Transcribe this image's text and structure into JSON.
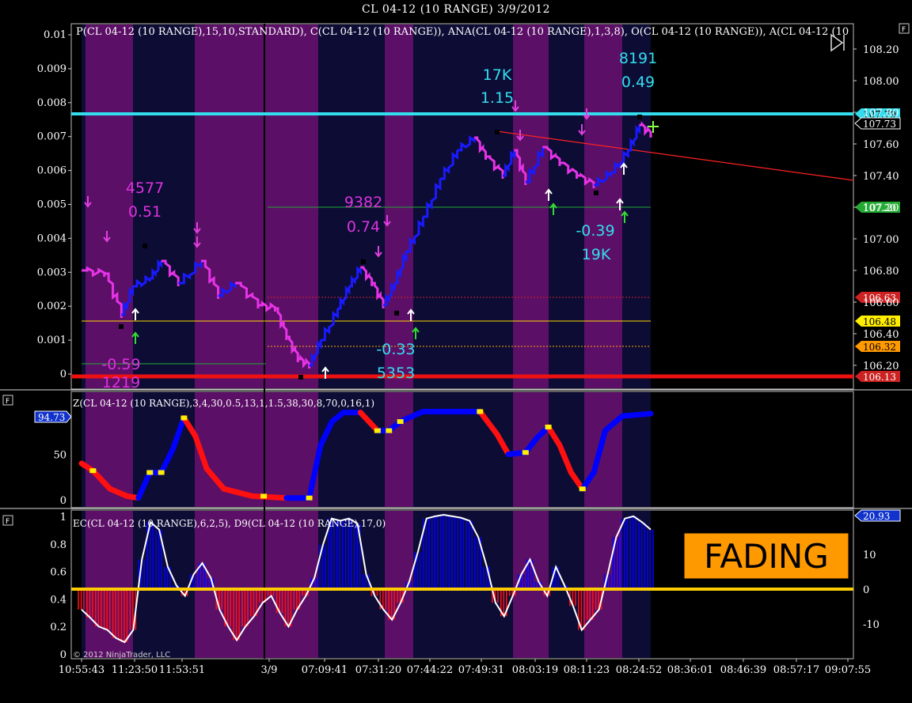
{
  "window": {
    "title": "CL 04-12 (10 RANGE)  3/9/2012"
  },
  "colors": {
    "band_purple": "#5b0f66",
    "band_navy": "#0c0c35",
    "up": "#1a1aff",
    "down": "#e633e6",
    "z_up": "#0000ff",
    "z_down": "#ff1010",
    "cyan": "#33ddee",
    "magenta": "#cc22cc",
    "yellow": "#ffd700",
    "red_line": "#ee1111",
    "orange_line": "#ffaa00"
  },
  "chart_data": [
    {
      "type": "line",
      "name": "price-panel",
      "title": "P(CL 04-12 (10 RANGE),15,10,STANDARD), C(CL 04-12 (10 RANGE)), ANA(CL 04-12 (10 RANGE),1,3,8), O(CL 04-12 (10 RANGE)), A(CL 04-12 (10",
      "flag": "F",
      "left_axis": {
        "ylim": [
          0,
          0.01
        ],
        "ticks": [
          "0.01",
          "0.009",
          "0.008",
          "0.007",
          "0.006",
          "0.005",
          "0.004",
          "0.003",
          "0.002",
          "0.001",
          "0"
        ]
      },
      "right_axis": {
        "ylim": [
          106.13,
          108.31
        ],
        "ticks": [
          "108.20",
          "108.00",
          "107.80",
          "107.60",
          "107.40",
          "107.20",
          "107.00",
          "106.80",
          "106.60",
          "106.40",
          "106.20"
        ]
      },
      "price_markers": [
        {
          "text": "107.79",
          "value": 107.79,
          "color": "#33ddee"
        },
        {
          "text": "107.73",
          "value": 107.73,
          "color": "#ffffff"
        },
        {
          "text": "107.20",
          "value": 107.2,
          "color": "#22aa33"
        },
        {
          "text": "106.63",
          "value": 106.63,
          "color": "#cc2222"
        },
        {
          "text": "106.48",
          "value": 106.48,
          "color": "#ffee00"
        },
        {
          "text": "106.32",
          "value": 106.32,
          "color": "#ff9900"
        },
        {
          "text": "106.13",
          "value": 106.13,
          "color": "#cc2222"
        }
      ],
      "price_line": [
        {
          "t": 0,
          "v": 106.8
        },
        {
          "t": 0.04,
          "v": 106.78
        },
        {
          "t": 0.07,
          "v": 106.52
        },
        {
          "t": 0.09,
          "v": 106.7
        },
        {
          "t": 0.12,
          "v": 106.75
        },
        {
          "t": 0.14,
          "v": 106.86
        },
        {
          "t": 0.17,
          "v": 106.72
        },
        {
          "t": 0.21,
          "v": 106.86
        },
        {
          "t": 0.24,
          "v": 106.64
        },
        {
          "t": 0.27,
          "v": 106.72
        },
        {
          "t": 0.31,
          "v": 106.58
        },
        {
          "t": 0.34,
          "v": 106.56
        },
        {
          "t": 0.36,
          "v": 106.38
        },
        {
          "t": 0.38,
          "v": 106.24
        },
        {
          "t": 0.4,
          "v": 106.2
        },
        {
          "t": 0.42,
          "v": 106.36
        },
        {
          "t": 0.45,
          "v": 106.56
        },
        {
          "t": 0.47,
          "v": 106.7
        },
        {
          "t": 0.49,
          "v": 106.82
        },
        {
          "t": 0.51,
          "v": 106.72
        },
        {
          "t": 0.53,
          "v": 106.58
        },
        {
          "t": 0.55,
          "v": 106.72
        },
        {
          "t": 0.57,
          "v": 106.92
        },
        {
          "t": 0.6,
          "v": 107.14
        },
        {
          "t": 0.63,
          "v": 107.38
        },
        {
          "t": 0.66,
          "v": 107.56
        },
        {
          "t": 0.69,
          "v": 107.64
        },
        {
          "t": 0.71,
          "v": 107.52
        },
        {
          "t": 0.74,
          "v": 107.4
        },
        {
          "t": 0.76,
          "v": 107.56
        },
        {
          "t": 0.78,
          "v": 107.36
        },
        {
          "t": 0.81,
          "v": 107.58
        },
        {
          "t": 0.84,
          "v": 107.48
        },
        {
          "t": 0.87,
          "v": 107.4
        },
        {
          "t": 0.9,
          "v": 107.34
        },
        {
          "t": 0.93,
          "v": 107.42
        },
        {
          "t": 0.96,
          "v": 107.56
        },
        {
          "t": 0.98,
          "v": 107.72
        },
        {
          "t": 1.0,
          "v": 107.66
        }
      ],
      "annotations": [
        {
          "text": "4577",
          "color": "#dd33dd"
        },
        {
          "text": "0.51",
          "color": "#dd33dd"
        },
        {
          "text": "9382",
          "color": "#dd33dd"
        },
        {
          "text": "0.74",
          "color": "#dd33dd"
        },
        {
          "text": "17K",
          "color": "#33ddee"
        },
        {
          "text": "1.15",
          "color": "#33ddee"
        },
        {
          "text": "8191",
          "color": "#33ddee"
        },
        {
          "text": "0.49",
          "color": "#33ddee"
        },
        {
          "text": "-0.39",
          "color": "#33ddee"
        },
        {
          "text": "19K",
          "color": "#33ddee"
        },
        {
          "text": "-0.33",
          "color": "#33ddee"
        },
        {
          "text": "5353",
          "color": "#33ddee"
        },
        {
          "text": "-0.59",
          "color": "#dd33dd"
        },
        {
          "text": "1219",
          "color": "#dd33dd"
        }
      ]
    },
    {
      "type": "line",
      "name": "z-panel",
      "title": "Z(CL 04-12 (10 RANGE),3,4,30,0.5,13,1,1.5,38,30,8,70,0,16,1)",
      "flag": "F",
      "left_axis": {
        "ylim": [
          0,
          100
        ],
        "ticks": [
          "50",
          "0"
        ]
      },
      "current_value": "94.73",
      "z_line": [
        {
          "t": 0,
          "v": 40
        },
        {
          "t": 0.02,
          "v": 32
        },
        {
          "t": 0.05,
          "v": 12
        },
        {
          "t": 0.08,
          "v": 4
        },
        {
          "t": 0.1,
          "v": 2
        },
        {
          "t": 0.12,
          "v": 30
        },
        {
          "t": 0.14,
          "v": 30
        },
        {
          "t": 0.16,
          "v": 55
        },
        {
          "t": 0.18,
          "v": 90
        },
        {
          "t": 0.2,
          "v": 70
        },
        {
          "t": 0.22,
          "v": 34
        },
        {
          "t": 0.25,
          "v": 12
        },
        {
          "t": 0.3,
          "v": 4
        },
        {
          "t": 0.36,
          "v": 2
        },
        {
          "t": 0.4,
          "v": 2
        },
        {
          "t": 0.42,
          "v": 60
        },
        {
          "t": 0.44,
          "v": 86
        },
        {
          "t": 0.46,
          "v": 96
        },
        {
          "t": 0.49,
          "v": 96
        },
        {
          "t": 0.52,
          "v": 76
        },
        {
          "t": 0.54,
          "v": 76
        },
        {
          "t": 0.56,
          "v": 86
        },
        {
          "t": 0.6,
          "v": 97
        },
        {
          "t": 0.66,
          "v": 97
        },
        {
          "t": 0.7,
          "v": 97
        },
        {
          "t": 0.73,
          "v": 72
        },
        {
          "t": 0.75,
          "v": 50
        },
        {
          "t": 0.78,
          "v": 52
        },
        {
          "t": 0.8,
          "v": 68
        },
        {
          "t": 0.82,
          "v": 80
        },
        {
          "t": 0.84,
          "v": 60
        },
        {
          "t": 0.86,
          "v": 30
        },
        {
          "t": 0.88,
          "v": 12
        },
        {
          "t": 0.9,
          "v": 30
        },
        {
          "t": 0.92,
          "v": 76
        },
        {
          "t": 0.95,
          "v": 92
        },
        {
          "t": 1.0,
          "v": 94.73
        }
      ]
    },
    {
      "type": "bar",
      "name": "ec-panel",
      "title": "EC(CL 04-12 (10 RANGE),6,2,5), D9(CL 04-12 (10 RANGE),17,0)",
      "flag": "F",
      "left_axis": {
        "ylim": [
          0,
          1
        ],
        "ticks": [
          "1",
          "0.8",
          "0.6",
          "0.4",
          "0.2",
          "0"
        ]
      },
      "right_axis": {
        "ticks": [
          "10",
          "0",
          "-10"
        ]
      },
      "current_value": "20.93",
      "zero_line_value": 0,
      "histogram": [
        -0.3,
        -0.42,
        -0.55,
        -0.6,
        -0.72,
        -0.78,
        -0.6,
        0.4,
        0.9,
        0.8,
        0.3,
        0.05,
        -0.1,
        0.2,
        0.35,
        0.15,
        -0.3,
        -0.55,
        -0.75,
        -0.55,
        -0.4,
        -0.2,
        -0.1,
        -0.35,
        -0.55,
        -0.3,
        -0.1,
        0.15,
        0.6,
        0.95,
        0.92,
        0.95,
        0.88,
        0.2,
        -0.1,
        -0.3,
        -0.45,
        -0.2,
        0.1,
        0.5,
        0.95,
        0.98,
        1.0,
        0.98,
        0.96,
        0.92,
        0.7,
        0.3,
        -0.2,
        -0.4,
        -0.1,
        0.2,
        0.4,
        0.1,
        -0.1,
        0.3,
        0.05,
        -0.25,
        -0.6,
        -0.45,
        -0.3,
        0.2,
        0.7,
        0.95,
        0.98,
        0.9,
        0.8
      ],
      "fading_label": "FADING"
    }
  ],
  "x_axis": {
    "ticks": [
      "10:55:43",
      "11:23:50",
      "11:53:51",
      "3/9",
      "07:09:41",
      "07:31:20",
      "07:44:22",
      "07:49:31",
      "08:03:19",
      "08:11:23",
      "08:24:52",
      "08:36:01",
      "08:46:39",
      "08:57:17",
      "09:07:55"
    ]
  },
  "footer": {
    "copyright": "© 2012 NinjaTrader, LLC"
  }
}
